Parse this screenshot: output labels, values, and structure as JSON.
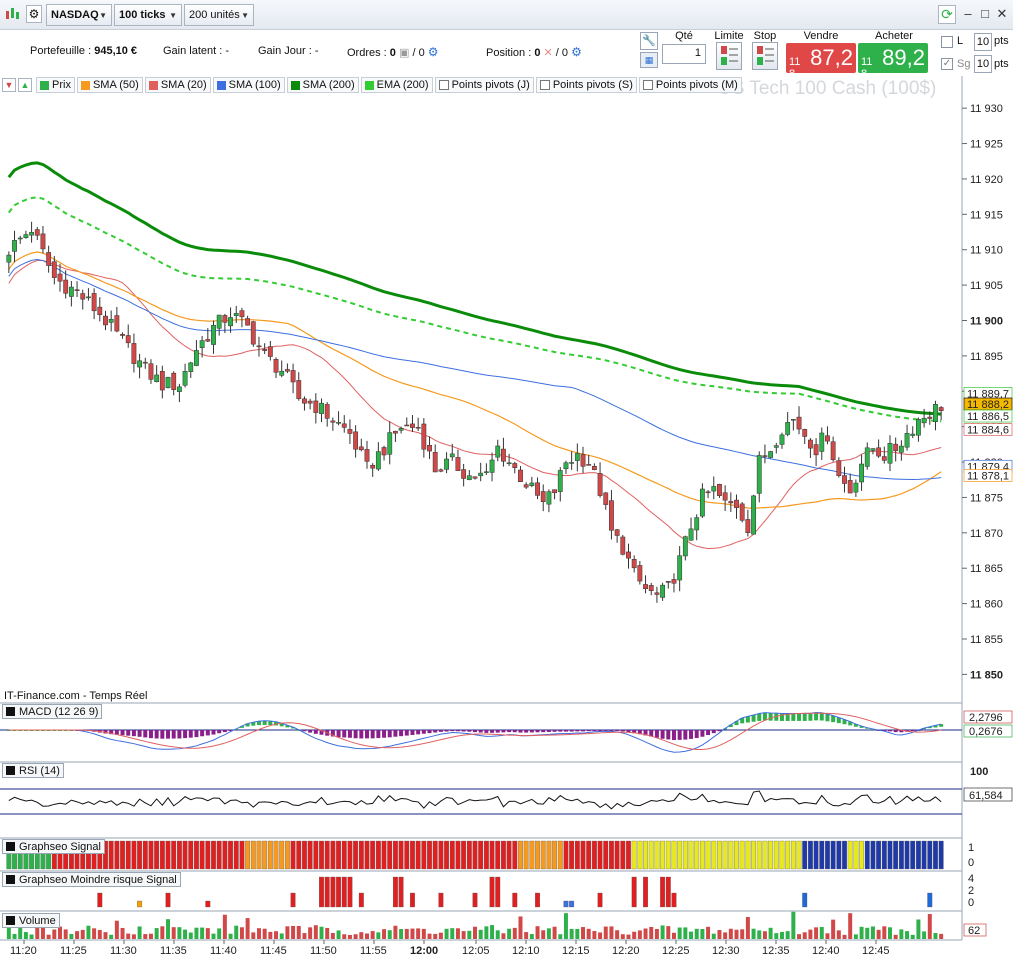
{
  "toolbar": {
    "market": "NASDAQ",
    "ticks": "100 ticks",
    "units": "200 unités"
  },
  "account": {
    "portfolio_label": "Portefeuille :",
    "portfolio_value": "945,10 €",
    "gain_latent_label": "Gain latent :",
    "gain_latent_value": "-",
    "gain_jour_label": "Gain Jour :",
    "gain_jour_value": "-",
    "ordres_label": "Ordres :",
    "ordres_a": "0",
    "ordres_b": "/ 0",
    "position_label": "Position :",
    "position_a": "0",
    "position_b": "/ 0"
  },
  "order": {
    "qty_label": "Qté",
    "qty_value": "1",
    "limit_label": "Limite",
    "stop_label": "Stop",
    "sell_label": "Vendre",
    "sell_prefix": "11 8",
    "sell_price": "87,2",
    "buy_label": "Acheter",
    "buy_prefix": "11 8",
    "buy_price": "89,2",
    "l_label": "L",
    "l_value": "10",
    "l_unit": "pts",
    "sg_label": "Sg",
    "sg_value": "10",
    "sg_unit": "pts",
    "sell_color": "#e04848",
    "buy_color": "#2eb14a"
  },
  "legend": [
    {
      "label": "Prix",
      "color": "#2eb14a",
      "kind": "swatch"
    },
    {
      "label": "SMA (50)",
      "color": "#f59a1e",
      "kind": "swatch"
    },
    {
      "label": "SMA (20)",
      "color": "#e06060",
      "kind": "swatch"
    },
    {
      "label": "SMA (100)",
      "color": "#3d6fe0",
      "kind": "swatch"
    },
    {
      "label": "SMA (200)",
      "color": "#0a8c0a",
      "kind": "swatch"
    },
    {
      "label": "EMA (200)",
      "color": "#33cc33",
      "kind": "swatch"
    },
    {
      "label": "Points pivots (J)",
      "kind": "checkbox"
    },
    {
      "label": "Points pivots (S)",
      "kind": "checkbox"
    },
    {
      "label": "Points pivots (M)",
      "kind": "checkbox"
    }
  ],
  "instrument_watermark": "US Tech 100 Cash (100$)",
  "credit": "IT-Finance.com - Temps Réel",
  "panes": {
    "macd": {
      "title": "MACD (12 26 9)",
      "v1": "2,2796",
      "v2": "0,2676"
    },
    "rsi": {
      "title": "RSI (14)",
      "top": "100",
      "value": "61,584"
    },
    "signal": {
      "title": "Graphseo Signal",
      "top": "1",
      "bottom": "0"
    },
    "risk": {
      "title": "Graphseo Moindre risque Signal",
      "top": "4",
      "mid": "2",
      "bottom": "0"
    },
    "volume": {
      "title": "Volume",
      "value": "62"
    }
  },
  "colors": {
    "up_candle": "#2eb14a",
    "down_candle": "#d04848",
    "sma20": "#e06060",
    "sma50": "#f59a1e",
    "sma100": "#3d6fe0",
    "sma200": "#0a8c0a",
    "ema200": "#33cc33"
  },
  "chart_data": {
    "type": "candlestick",
    "x_ticks": [
      "11:20",
      "11:25",
      "11:30",
      "11:35",
      "11:40",
      "11:45",
      "11:50",
      "11:55",
      "12:00",
      "12:05",
      "12:10",
      "12:15",
      "12:20",
      "12:25",
      "12:30",
      "12:35",
      "12:40",
      "12:45"
    ],
    "y_ticks": [
      11930,
      11925,
      11920,
      11915,
      11910,
      11905,
      11900,
      11895,
      11890,
      11885,
      11880,
      11875,
      11870,
      11865,
      11860,
      11855,
      11850
    ],
    "y_tick_labels": [
      "11 930",
      "11 925",
      "11 920",
      "11 915",
      "11 910",
      "11 905",
      "11 900",
      "11 895",
      "11 890",
      "11 885",
      "11 880",
      "11 875",
      "11 870",
      "11 865",
      "11 860",
      "11 855",
      "11 850"
    ],
    "ylim": [
      11848.5,
      11932
    ],
    "price_labels": [
      {
        "value": 11889.7,
        "text": "11 889,7",
        "color": "#33cc33",
        "bg": "#ffffff"
      },
      {
        "value": 11888.2,
        "text": "11 888,2",
        "color": "#111111",
        "bg": "#f5b800"
      },
      {
        "value": 11886.5,
        "text": "11 886,5",
        "color": "#33cc33",
        "bg": "#ffffff"
      },
      {
        "value": 11884.6,
        "text": "11 884,6",
        "color": "#e06060",
        "bg": "#ffffff"
      },
      {
        "value": 11879.4,
        "text": "11 879,4",
        "color": "#3d6fe0",
        "bg": "#ffffff"
      },
      {
        "value": 11878.1,
        "text": "11 878,1",
        "color": "#f59a1e",
        "bg": "#ffffff"
      }
    ],
    "close_path": [
      [
        0,
        11910
      ],
      [
        4,
        11913
      ],
      [
        8,
        11906
      ],
      [
        12,
        11904
      ],
      [
        16,
        11901
      ],
      [
        20,
        11897
      ],
      [
        24,
        11893
      ],
      [
        27,
        11891
      ],
      [
        30,
        11891
      ],
      [
        33,
        11896
      ],
      [
        36,
        11899
      ],
      [
        39,
        11901
      ],
      [
        42,
        11899
      ],
      [
        45,
        11895
      ],
      [
        48,
        11893
      ],
      [
        51,
        11889
      ],
      [
        54,
        11888
      ],
      [
        57,
        11886
      ],
      [
        60,
        11884
      ],
      [
        63,
        11879
      ],
      [
        66,
        11882
      ],
      [
        69,
        11885
      ],
      [
        72,
        11885
      ],
      [
        75,
        11879
      ],
      [
        78,
        11880
      ],
      [
        81,
        11878
      ],
      [
        84,
        11878
      ],
      [
        86,
        11882
      ],
      [
        88,
        11880
      ],
      [
        90,
        11878
      ],
      [
        92,
        11876
      ],
      [
        94,
        11874
      ],
      [
        96,
        11876
      ],
      [
        98,
        11880
      ],
      [
        100,
        11881
      ],
      [
        102,
        11880
      ],
      [
        104,
        11876
      ],
      [
        106,
        11870
      ],
      [
        108,
        11868
      ],
      [
        110,
        11864
      ],
      [
        112,
        11862
      ],
      [
        114,
        11861
      ],
      [
        116,
        11862
      ],
      [
        118,
        11866
      ],
      [
        120,
        11871
      ],
      [
        122,
        11875
      ],
      [
        124,
        11876
      ],
      [
        126,
        11874
      ],
      [
        128,
        11874
      ],
      [
        130,
        11871
      ],
      [
        132,
        11880
      ],
      [
        134,
        11882
      ],
      [
        136,
        11885
      ],
      [
        138,
        11886
      ],
      [
        140,
        11884
      ],
      [
        142,
        11882
      ],
      [
        144,
        11884
      ],
      [
        146,
        11878
      ],
      [
        148,
        11876
      ],
      [
        150,
        11880
      ],
      [
        152,
        11882
      ],
      [
        154,
        11881
      ],
      [
        156,
        11882
      ],
      [
        158,
        11884
      ],
      [
        160,
        11886
      ],
      [
        162,
        11887
      ],
      [
        164,
        11888
      ]
    ],
    "n_bars": 165
  }
}
